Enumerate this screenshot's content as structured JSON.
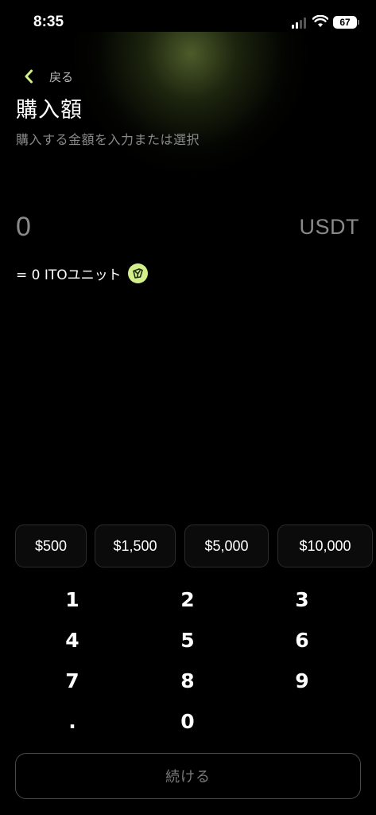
{
  "status_bar": {
    "time": "8:35",
    "battery": "67"
  },
  "nav": {
    "back_label": "戻る",
    "back_icon": "chevron-left-icon",
    "accent_color": "#d3ef8a"
  },
  "header": {
    "title": "購入額",
    "subtitle": "購入する金額を入力または選択"
  },
  "amount": {
    "value": "0",
    "currency": "USDT",
    "conversion": "= 0 ITOユニット",
    "unit_icon": "ito-token-icon"
  },
  "presets": [
    {
      "label": "$500"
    },
    {
      "label": "$1,500"
    },
    {
      "label": "$5,000"
    },
    {
      "label": "$10,000"
    }
  ],
  "keypad": {
    "keys": [
      "1",
      "2",
      "3",
      "4",
      "5",
      "6",
      "7",
      "8",
      "9",
      ".",
      "0"
    ]
  },
  "continue_button": {
    "label": "続ける"
  }
}
